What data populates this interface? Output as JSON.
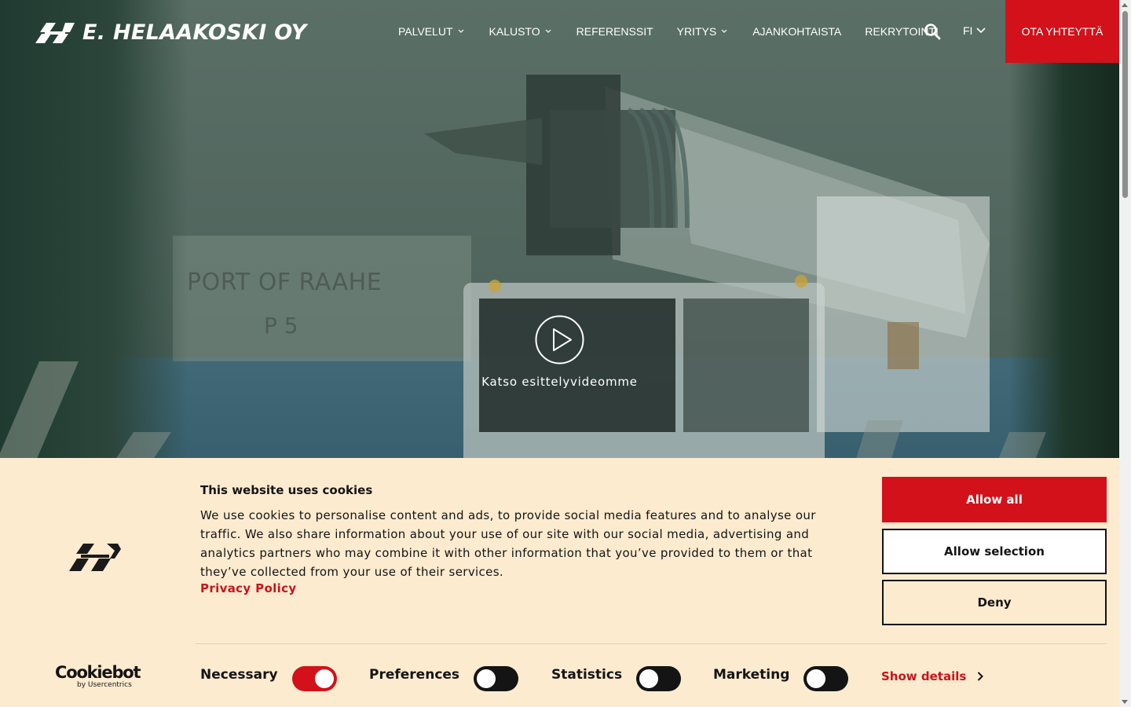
{
  "header": {
    "logo_text": "E. HELAAKOSKI OY",
    "nav": [
      {
        "label": "PALVELUT",
        "dropdown": true
      },
      {
        "label": "KALUSTO",
        "dropdown": true
      },
      {
        "label": "REFERENSSIT",
        "dropdown": false
      },
      {
        "label": "YRITYS",
        "dropdown": true
      },
      {
        "label": "AJANKOHTAISTA",
        "dropdown": false
      },
      {
        "label": "REKRYTOINTI",
        "dropdown": false
      }
    ],
    "search_icon": "search-icon",
    "language": "FI",
    "cta_label": "OTA YHTEYTTÄ",
    "cta_color": "#d3111b"
  },
  "hero": {
    "background_text_1": "PORT OF RAAHE",
    "background_text_2": "P 5",
    "play_icon": "play-icon",
    "play_label": "Katso esittelyvideomme"
  },
  "cookie_banner": {
    "title": "This website uses cookies",
    "body": "We use cookies to personalise content and ads, to provide social media features and to analyse our traffic. We also share information about your use of our site with our social media, advertising and analytics partners who may combine it with other information that you’ve provided to them or that they’ve collected from your use of their services.",
    "privacy_link": "Privacy Policy",
    "brand_name": "Cookiebot",
    "brand_sub": "by Usercentrics",
    "buttons": {
      "allow_all": "Allow all",
      "allow_selection": "Allow selection",
      "deny": "Deny"
    },
    "toggles": [
      {
        "label": "Necessary",
        "checked": true
      },
      {
        "label": "Preferences",
        "checked": false
      },
      {
        "label": "Statistics",
        "checked": false
      },
      {
        "label": "Marketing",
        "checked": false
      }
    ],
    "show_details": "Show details",
    "background_color": "#fdebd0",
    "accent_color": "#c8141b"
  }
}
